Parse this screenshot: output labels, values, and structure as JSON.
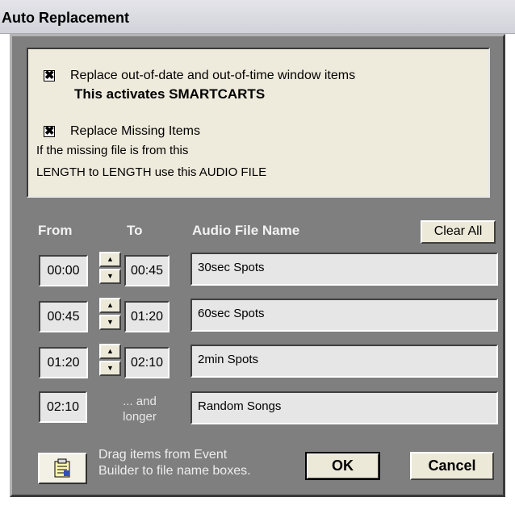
{
  "window": {
    "title": "Auto Replacement"
  },
  "info": {
    "replace_outdated": {
      "checked": true,
      "mark": "✖",
      "label": "Replace out-of-date and out-of-time window items",
      "note": "This activates SMARTCARTS"
    },
    "replace_missing": {
      "checked": true,
      "mark": "✖",
      "label": "Replace Missing Items",
      "desc1": "If the missing file is from this",
      "desc2": "LENGTH to LENGTH use this AUDIO FILE"
    }
  },
  "headers": {
    "from": "From",
    "to": "To",
    "audio": "Audio File Name"
  },
  "clear_all_label": "Clear All",
  "rows": [
    {
      "from": "00:00",
      "to": "00:45",
      "audio": "30sec Spots"
    },
    {
      "from": "00:45",
      "to": "01:20",
      "audio": "60sec Spots"
    },
    {
      "from": "01:20",
      "to": "02:10",
      "audio": "2min Spots"
    },
    {
      "from": "02:10",
      "to_label_line1": "... and",
      "to_label_line2": "longer",
      "audio": "Random Songs"
    }
  ],
  "spinner": {
    "up": "▲",
    "down": "▼"
  },
  "icons": {
    "event_builder": "event-builder-icon"
  },
  "hint": {
    "line1": "Drag items from Event",
    "line2": "Builder to file name boxes."
  },
  "ok_label": "OK",
  "cancel_label": "Cancel",
  "colors": {
    "dialog_bg": "#7f7f7f",
    "info_bg": "#efebdc",
    "field_bg": "#e6e6e6"
  }
}
